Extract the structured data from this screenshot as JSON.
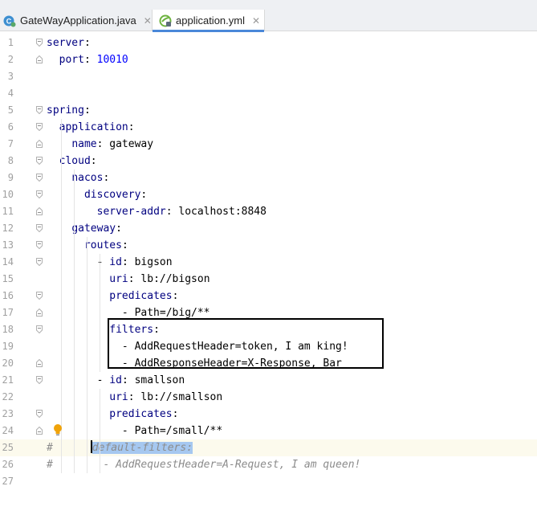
{
  "tabs": [
    {
      "label": "GateWayApplication.java",
      "icon": "java-class-icon",
      "close": "✕",
      "active": false
    },
    {
      "label": "application.yml",
      "icon": "spring-yml-icon",
      "close": "✕",
      "active": true
    }
  ],
  "colors": {
    "key": "#000080",
    "number": "#0000ff",
    "comment": "#8c8c8c",
    "selection": "#a6c8f0",
    "highlight_box": "#000000"
  },
  "editor": {
    "current_line": 25,
    "lines": [
      {
        "n": "1",
        "indent": "",
        "key": "server",
        "sep": ":",
        "value": ""
      },
      {
        "n": "2",
        "indent": "  ",
        "key": "port",
        "sep": ": ",
        "value": "10010",
        "value_type": "number"
      },
      {
        "n": "3",
        "indent": "",
        "key": "",
        "sep": "",
        "value": ""
      },
      {
        "n": "4",
        "indent": "",
        "key": "",
        "sep": "",
        "value": ""
      },
      {
        "n": "5",
        "indent": "",
        "key": "spring",
        "sep": ":",
        "value": ""
      },
      {
        "n": "6",
        "indent": "  ",
        "key": "application",
        "sep": ":",
        "value": ""
      },
      {
        "n": "7",
        "indent": "    ",
        "key": "name",
        "sep": ": ",
        "value": "gateway"
      },
      {
        "n": "8",
        "indent": "  ",
        "key": "cloud",
        "sep": ":",
        "value": ""
      },
      {
        "n": "9",
        "indent": "    ",
        "key": "nacos",
        "sep": ":",
        "value": ""
      },
      {
        "n": "10",
        "indent": "      ",
        "key": "discovery",
        "sep": ":",
        "value": ""
      },
      {
        "n": "11",
        "indent": "        ",
        "key": "server-addr",
        "sep": ": ",
        "value": "localhost:8848"
      },
      {
        "n": "12",
        "indent": "    ",
        "key": "gateway",
        "sep": ":",
        "value": ""
      },
      {
        "n": "13",
        "indent": "      ",
        "key": "routes",
        "sep": ":",
        "value": ""
      },
      {
        "n": "14",
        "indent": "        - ",
        "key": "id",
        "sep": ": ",
        "value": "bigson"
      },
      {
        "n": "15",
        "indent": "          ",
        "key": "uri",
        "sep": ": ",
        "value": "lb://bigson"
      },
      {
        "n": "16",
        "indent": "          ",
        "key": "predicates",
        "sep": ":",
        "value": ""
      },
      {
        "n": "17",
        "indent": "            - ",
        "key": "",
        "sep": "",
        "value": "Path=/big/**"
      },
      {
        "n": "18",
        "indent": "          ",
        "key": "filters",
        "sep": ":",
        "value": ""
      },
      {
        "n": "19",
        "indent": "            - ",
        "key": "",
        "sep": "",
        "value": "AddRequestHeader=token, I am king!"
      },
      {
        "n": "20",
        "indent": "            - ",
        "key": "",
        "sep": "",
        "value": "AddResponseHeader=X-Response, Bar"
      },
      {
        "n": "21",
        "indent": "        - ",
        "key": "id",
        "sep": ": ",
        "value": "smallson"
      },
      {
        "n": "22",
        "indent": "          ",
        "key": "uri",
        "sep": ": ",
        "value": "lb://smallson"
      },
      {
        "n": "23",
        "indent": "          ",
        "key": "predicates",
        "sep": ":",
        "value": ""
      },
      {
        "n": "24",
        "indent": "            - ",
        "key": "",
        "sep": "",
        "value": "Path=/small/**"
      },
      {
        "n": "25",
        "comment_prefix": "#",
        "comment_text": "default-filters:"
      },
      {
        "n": "26",
        "comment_prefix": "#",
        "comment_text": "- AddRequestHeader=A-Request, I am queen!"
      },
      {
        "n": "27",
        "indent": "",
        "key": "",
        "sep": "",
        "value": ""
      }
    ]
  }
}
